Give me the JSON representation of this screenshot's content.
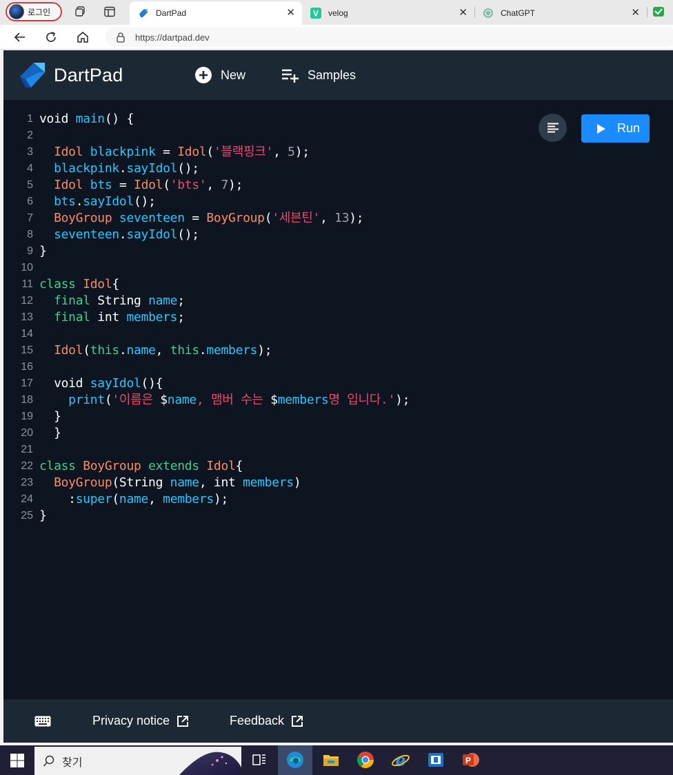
{
  "browser": {
    "profile_label": "로그인",
    "tabs": [
      {
        "title": "DartPad",
        "active": true
      },
      {
        "title": "velog",
        "active": false
      },
      {
        "title": "ChatGPT",
        "active": false
      }
    ],
    "close_glyph": "✕",
    "url": "https://dartpad.dev"
  },
  "app": {
    "title": "DartPad",
    "header_buttons": {
      "new_label": "New",
      "samples_label": "Samples"
    },
    "run_label": "Run",
    "accent_color": "#1a8cff",
    "header_bg": "#1c2834",
    "editor_bg": "#0d1520"
  },
  "code": {
    "line_numbers": [
      "1",
      "2",
      "3",
      "4",
      "5",
      "6",
      "7",
      "8",
      "9",
      "10",
      "11",
      "12",
      "13",
      "14",
      "15",
      "16",
      "17",
      "18",
      "19",
      "20",
      "21",
      "22",
      "23",
      "24",
      "25"
    ],
    "lines": [
      [
        [
          "pl",
          "void "
        ],
        [
          "fn",
          "main"
        ],
        [
          "pl",
          "() {"
        ]
      ],
      [],
      [
        [
          "pl",
          "  "
        ],
        [
          "ty",
          "Idol"
        ],
        [
          "pl",
          " "
        ],
        [
          "fn",
          "blackpink"
        ],
        [
          "pl",
          " = "
        ],
        [
          "ty",
          "Idol"
        ],
        [
          "pl",
          "("
        ],
        [
          "st",
          "'블랙핑크'"
        ],
        [
          "pl",
          ", "
        ],
        [
          "nu",
          "5"
        ],
        [
          "pl",
          ");"
        ]
      ],
      [
        [
          "pl",
          "  "
        ],
        [
          "fn",
          "blackpink"
        ],
        [
          "pl",
          "."
        ],
        [
          "fn",
          "sayIdol"
        ],
        [
          "pl",
          "();"
        ]
      ],
      [
        [
          "pl",
          "  "
        ],
        [
          "ty",
          "Idol"
        ],
        [
          "pl",
          " "
        ],
        [
          "fn",
          "bts"
        ],
        [
          "pl",
          " = "
        ],
        [
          "ty",
          "Idol"
        ],
        [
          "pl",
          "("
        ],
        [
          "st",
          "'bts'"
        ],
        [
          "pl",
          ", "
        ],
        [
          "nu",
          "7"
        ],
        [
          "pl",
          ");"
        ]
      ],
      [
        [
          "pl",
          "  "
        ],
        [
          "fn",
          "bts"
        ],
        [
          "pl",
          "."
        ],
        [
          "fn",
          "sayIdol"
        ],
        [
          "pl",
          "();"
        ]
      ],
      [
        [
          "pl",
          "  "
        ],
        [
          "ty",
          "BoyGroup"
        ],
        [
          "pl",
          " "
        ],
        [
          "fn",
          "seventeen"
        ],
        [
          "pl",
          " = "
        ],
        [
          "ty",
          "BoyGroup"
        ],
        [
          "pl",
          "("
        ],
        [
          "st",
          "'세븐틴'"
        ],
        [
          "pl",
          ", "
        ],
        [
          "nu",
          "13"
        ],
        [
          "pl",
          ");"
        ]
      ],
      [
        [
          "pl",
          "  "
        ],
        [
          "fn",
          "seventeen"
        ],
        [
          "pl",
          "."
        ],
        [
          "fn",
          "sayIdol"
        ],
        [
          "pl",
          "();"
        ]
      ],
      [
        [
          "pl",
          "}"
        ]
      ],
      [],
      [
        [
          "kw",
          "class"
        ],
        [
          "pl",
          " "
        ],
        [
          "ty",
          "Idol"
        ],
        [
          "pl",
          "{"
        ]
      ],
      [
        [
          "pl",
          "  "
        ],
        [
          "kw",
          "final"
        ],
        [
          "pl",
          " String "
        ],
        [
          "fn",
          "name"
        ],
        [
          "pl",
          ";"
        ]
      ],
      [
        [
          "pl",
          "  "
        ],
        [
          "kw",
          "final"
        ],
        [
          "pl",
          " int "
        ],
        [
          "fn",
          "members"
        ],
        [
          "pl",
          ";"
        ]
      ],
      [],
      [
        [
          "pl",
          "  "
        ],
        [
          "ty",
          "Idol"
        ],
        [
          "pl",
          "("
        ],
        [
          "kw",
          "this"
        ],
        [
          "pl",
          "."
        ],
        [
          "fn",
          "name"
        ],
        [
          "pl",
          ", "
        ],
        [
          "kw",
          "this"
        ],
        [
          "pl",
          "."
        ],
        [
          "fn",
          "members"
        ],
        [
          "pl",
          ");"
        ]
      ],
      [],
      [
        [
          "pl",
          "  void "
        ],
        [
          "fn",
          "sayIdol"
        ],
        [
          "pl",
          "(){"
        ]
      ],
      [
        [
          "pl",
          "    "
        ],
        [
          "fn",
          "print"
        ],
        [
          "pl",
          "("
        ],
        [
          "st",
          "'이름은 "
        ],
        [
          "pl",
          "$"
        ],
        [
          "fn",
          "name"
        ],
        [
          "st",
          ", 맴버 수는 "
        ],
        [
          "pl",
          "$"
        ],
        [
          "fn",
          "members"
        ],
        [
          "st",
          "명 입니다.'"
        ],
        [
          "pl",
          ");"
        ]
      ],
      [
        [
          "pl",
          "  }"
        ]
      ],
      [
        [
          "pl",
          "  }"
        ]
      ],
      [],
      [
        [
          "kw",
          "class"
        ],
        [
          "pl",
          " "
        ],
        [
          "ty",
          "BoyGroup"
        ],
        [
          "pl",
          " "
        ],
        [
          "kw",
          "extends"
        ],
        [
          "pl",
          " "
        ],
        [
          "ty",
          "Idol"
        ],
        [
          "pl",
          "{"
        ]
      ],
      [
        [
          "pl",
          "  "
        ],
        [
          "ty",
          "BoyGroup"
        ],
        [
          "pl",
          "(String "
        ],
        [
          "fn",
          "name"
        ],
        [
          "pl",
          ", int "
        ],
        [
          "fn",
          "members"
        ],
        [
          "pl",
          ")"
        ]
      ],
      [
        [
          "pl",
          "    :"
        ],
        [
          "fn",
          "super"
        ],
        [
          "pl",
          "("
        ],
        [
          "fn",
          "name"
        ],
        [
          "pl",
          ", "
        ],
        [
          "fn",
          "members"
        ],
        [
          "pl",
          ");"
        ]
      ],
      [
        [
          "pl",
          "}"
        ]
      ]
    ]
  },
  "footer": {
    "privacy_label": "Privacy notice",
    "feedback_label": "Feedback"
  },
  "taskbar": {
    "search_label": "찾기"
  }
}
